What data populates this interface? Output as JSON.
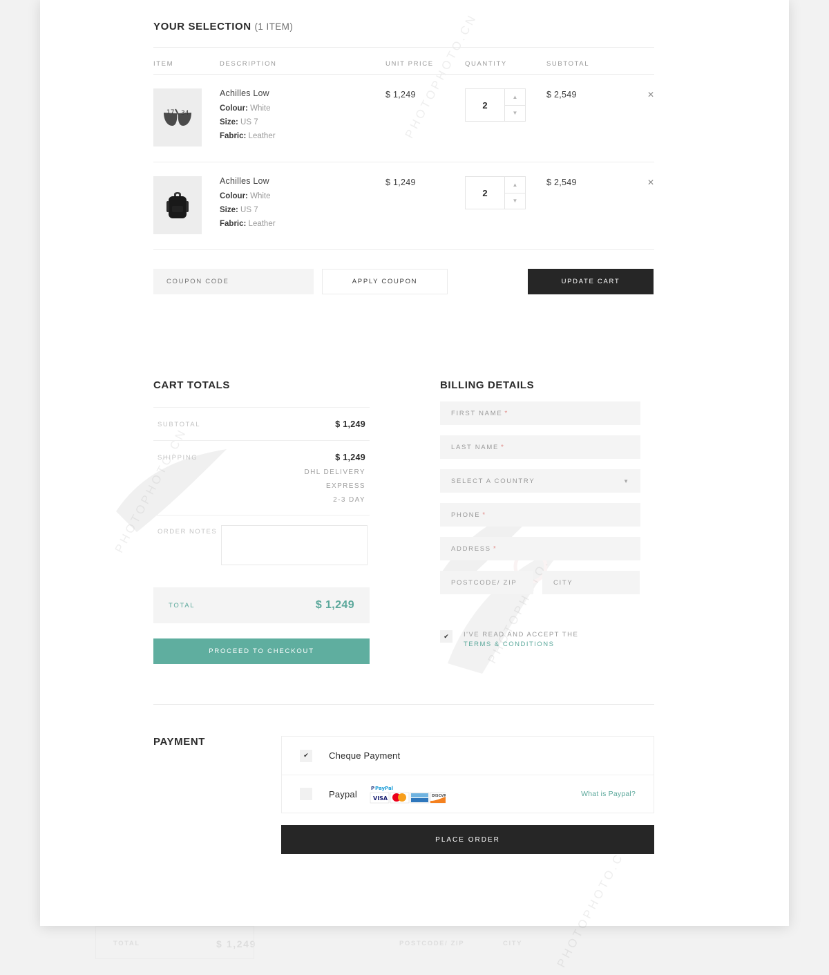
{
  "cart": {
    "title": "YOUR SELECTION",
    "title_suffix": "(1 ITEM)",
    "columns": [
      "ITEM",
      "DESCRIPTION",
      "UNIT PRICE",
      "QUANTITY",
      "SUBTOTAL"
    ],
    "items": [
      {
        "thumb_icon": "sunglasses-thumbnail",
        "name": "Achilles Low",
        "colour_label": "Colour:",
        "colour": "White",
        "size_label": "Size:",
        "size": "US 7",
        "fabric_label": "Fabric:",
        "fabric": "Leather",
        "unit_price": "$ 1,249",
        "quantity": "2",
        "subtotal": "$ 2,549",
        "remove_icon": "✕"
      },
      {
        "thumb_icon": "backpack-thumbnail",
        "name": "Achilles Low",
        "colour_label": "Colour:",
        "colour": "White",
        "size_label": "Size:",
        "size": "US 7",
        "fabric_label": "Fabric:",
        "fabric": "Leather",
        "unit_price": "$ 1,249",
        "quantity": "2",
        "subtotal": "$ 2,549",
        "remove_icon": "✕"
      }
    ],
    "coupon_placeholder": "COUPON CODE",
    "coupon_value": "",
    "apply_coupon_label": "APPLY COUPON",
    "update_cart_label": "UPDATE CART"
  },
  "totals": {
    "title": "CART TOTALS",
    "subtotal_label": "SUBTOTAL",
    "subtotal_value": "$ 1,249",
    "shipping_label": "SHIPPING",
    "shipping_value": "$ 1,249",
    "shipping_lines": [
      "DHL DELIVERY",
      "EXPRESS",
      "2-3 DAY"
    ],
    "notes_label": "ORDER NOTES",
    "notes_value": "",
    "total_label": "TOTAL",
    "total_value": "$ 1,249",
    "checkout_label": "PROCEED TO CHECKOUT"
  },
  "billing": {
    "title": "BILLING DETAILS",
    "fields": [
      {
        "placeholder": "FIRST NAME",
        "required": "*",
        "value": ""
      },
      {
        "placeholder": "LAST NAME",
        "required": "*",
        "value": ""
      },
      {
        "placeholder": "SELECT A COUNTRY",
        "required": "",
        "value": "",
        "chevron": "chevron-down-icon"
      },
      {
        "placeholder": "PHONE",
        "required": "*",
        "value": ""
      },
      {
        "placeholder": "ADDRESS",
        "required": "*",
        "value": ""
      }
    ],
    "postcode_placeholder": "POSTCODE/ ZIP",
    "postcode_value": "",
    "city_placeholder": "CITY",
    "city_value": "",
    "terms_checked": true,
    "terms_check_glyph": "✔",
    "terms_line1": "I'VE READ AND ACCEPT THE",
    "terms_link": "TERMS & CONDITIONS"
  },
  "payment": {
    "title": "PAYMENT",
    "options": [
      {
        "label": "Cheque Payment",
        "selected": true,
        "check_glyph": "✔"
      },
      {
        "label": "Paypal",
        "selected": false,
        "check_glyph": "✔"
      }
    ],
    "card_logos": [
      "paypal",
      "visa",
      "mastercard",
      "amex",
      "discover"
    ],
    "what_is_paypal": "What is Paypal?",
    "place_order_label": "PLACE ORDER"
  },
  "colors": {
    "accent_teal": "#5fae9f",
    "dark": "#262626",
    "required_red": "#e2918e",
    "field_bg": "#f4f4f4"
  },
  "watermark": {
    "text": "PHOTOPHOTO.CN"
  }
}
